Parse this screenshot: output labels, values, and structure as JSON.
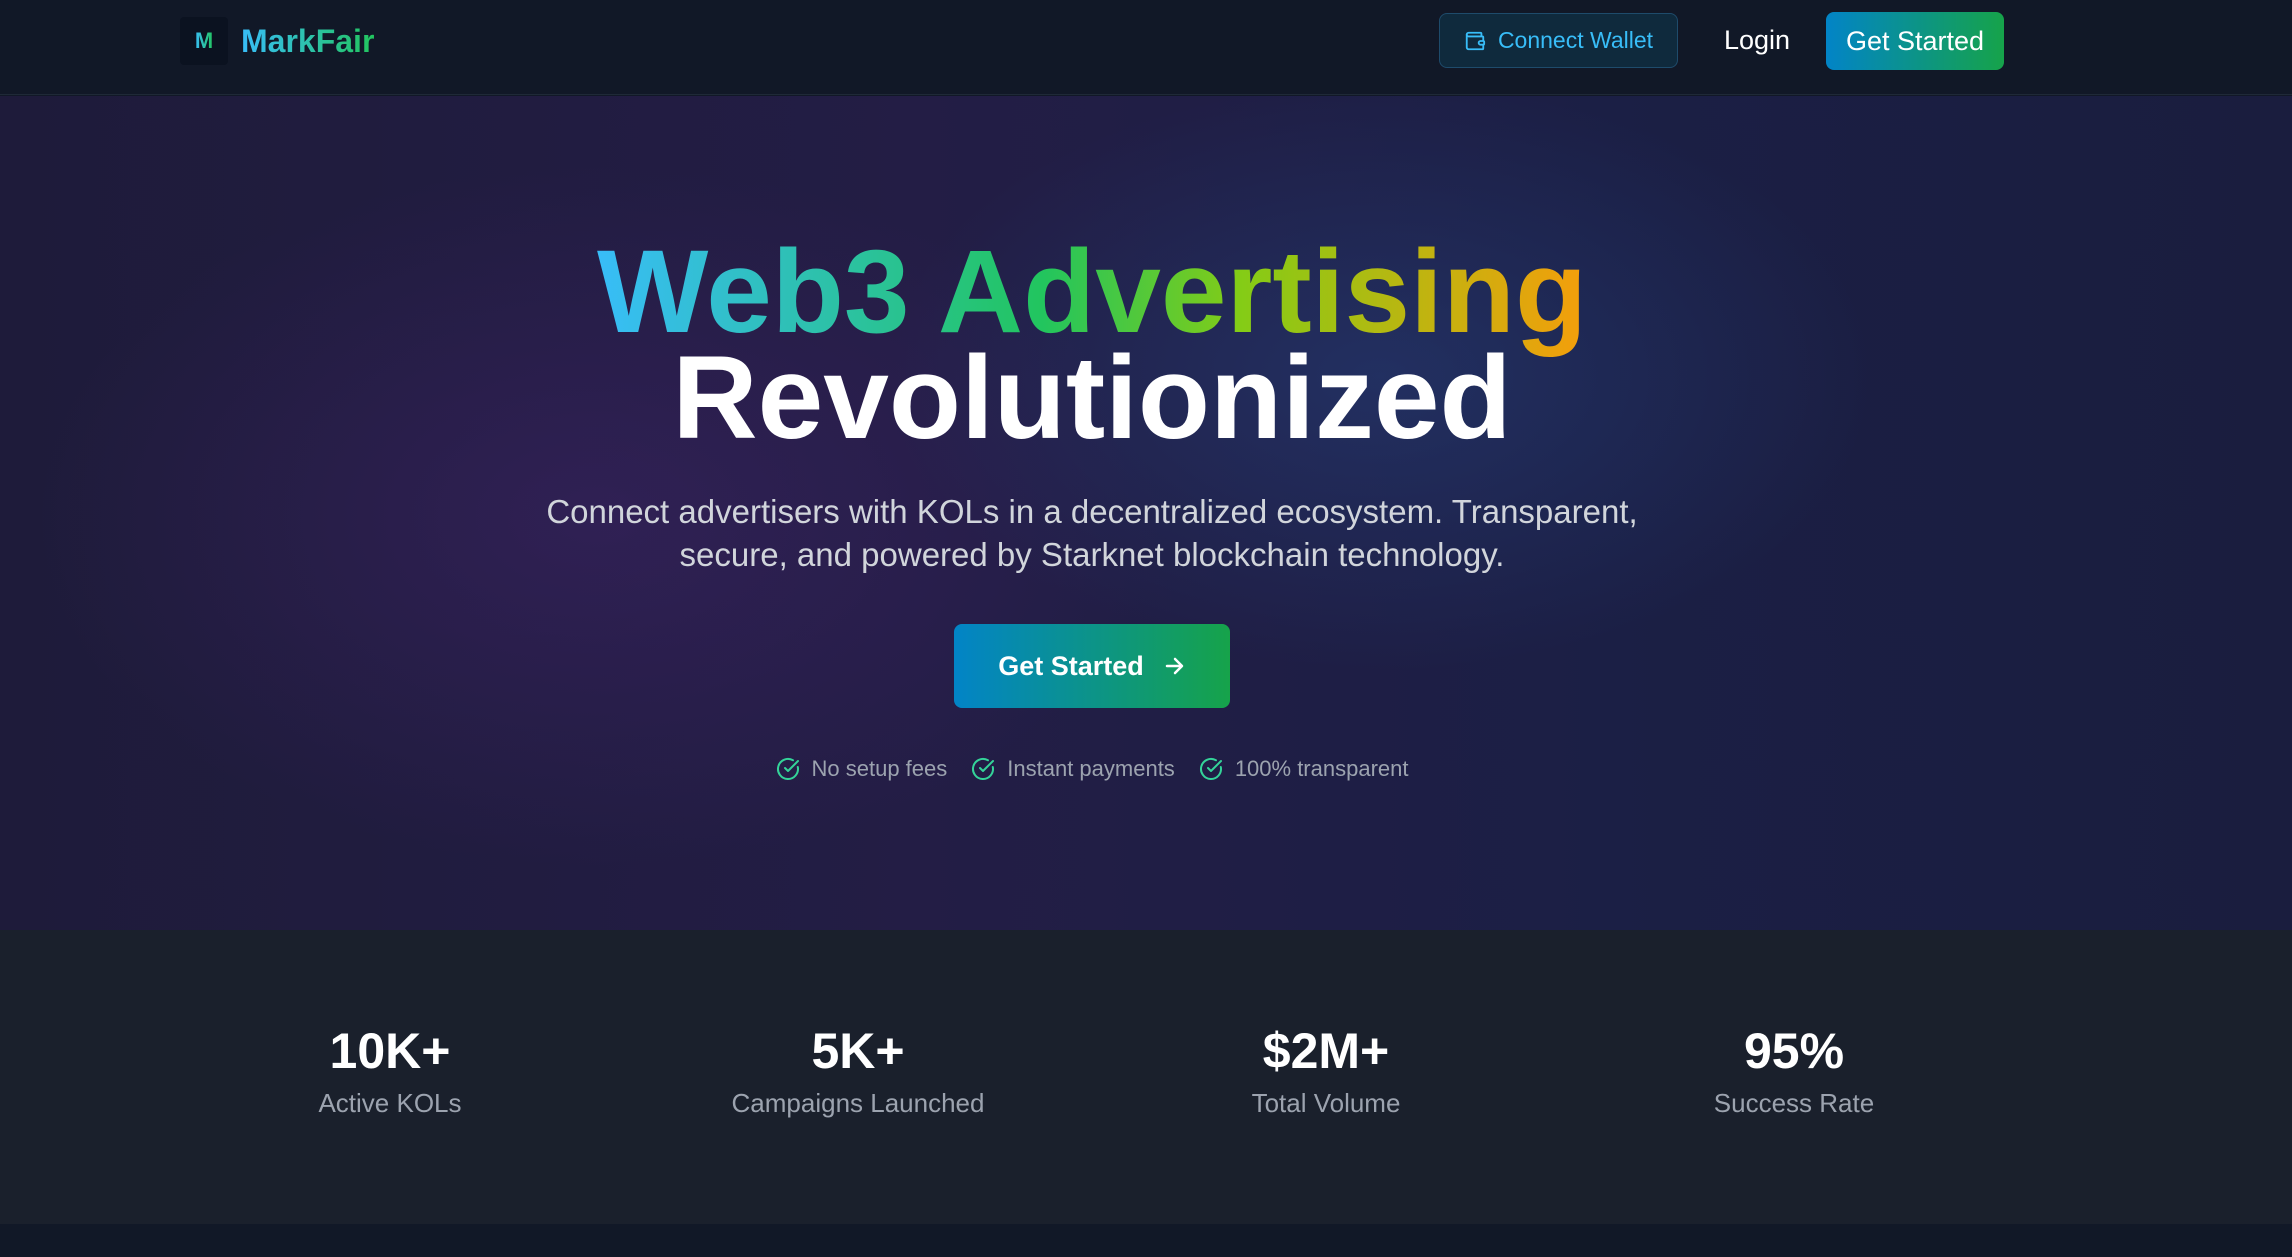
{
  "nav": {
    "logo_letter": "M",
    "brand": "MarkFair",
    "connect_wallet": "Connect Wallet",
    "login": "Login",
    "get_started": "Get Started"
  },
  "hero": {
    "title_gradient": "Web3 Advertising",
    "title_plain": "Revolutionized",
    "subtitle_line1": "Connect advertisers with KOLs in a decentralized ecosystem. Transparent,",
    "subtitle_line2": "secure, and powered by Starknet blockchain technology.",
    "cta": "Get Started",
    "features": [
      "No setup fees",
      "Instant payments",
      "100% transparent"
    ]
  },
  "stats": [
    {
      "value": "10K+",
      "label": "Active KOLs"
    },
    {
      "value": "5K+",
      "label": "Campaigns Launched"
    },
    {
      "value": "$2M+",
      "label": "Total Volume"
    },
    {
      "value": "95%",
      "label": "Success Rate"
    }
  ],
  "colors": {
    "accent_blue": "#38bdf8",
    "accent_green": "#22c55e",
    "accent_orange": "#f59e0b",
    "check_green": "#34d399"
  },
  "icons": {
    "wallet": "wallet-icon",
    "arrow": "arrow-right-icon",
    "check": "check-circle-icon"
  }
}
